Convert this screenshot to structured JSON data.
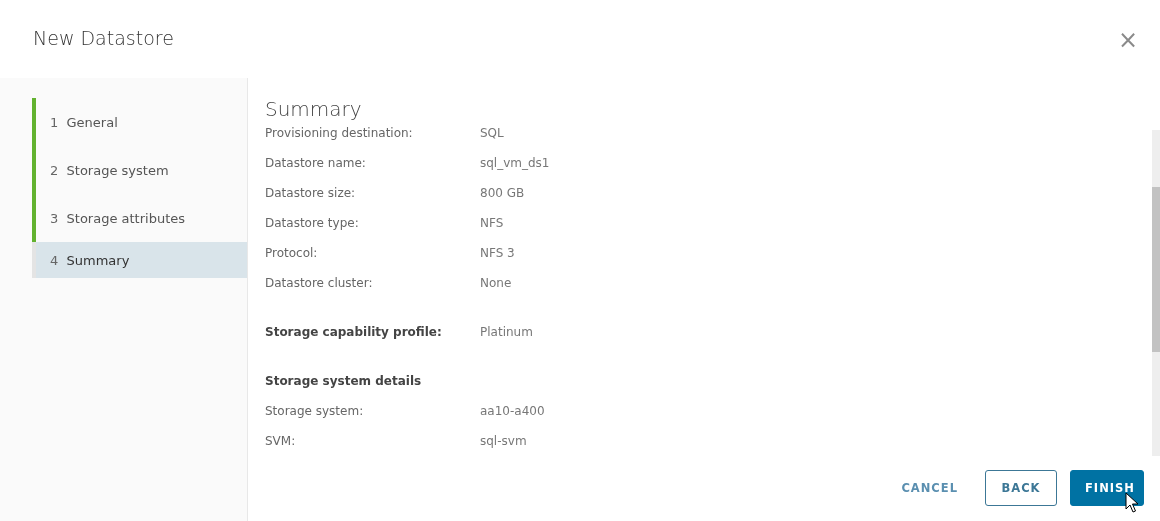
{
  "dialog": {
    "title": "New Datastore",
    "close_label": "×"
  },
  "steps": [
    {
      "number": "1",
      "label": "General",
      "completed": true,
      "selected": false
    },
    {
      "number": "2",
      "label": "Storage system",
      "completed": true,
      "selected": false
    },
    {
      "number": "3",
      "label": "Storage attributes",
      "completed": true,
      "selected": false
    },
    {
      "number": "4",
      "label": "Summary",
      "completed": false,
      "selected": true
    }
  ],
  "content": {
    "heading": "Summary",
    "rows": [
      {
        "kind": "field",
        "label": "Provisioning destination:",
        "value": "SQL"
      },
      {
        "kind": "field",
        "label": "Datastore name:",
        "value": "sql_vm_ds1"
      },
      {
        "kind": "field",
        "label": "Datastore size:",
        "value": "800 GB"
      },
      {
        "kind": "field",
        "label": "Datastore type:",
        "value": "NFS"
      },
      {
        "kind": "field",
        "label": "Protocol:",
        "value": "NFS 3"
      },
      {
        "kind": "field",
        "label": "Datastore cluster:",
        "value": "None"
      },
      {
        "kind": "emphasized",
        "label": "Storage capability profile:",
        "value": "Platinum"
      },
      {
        "kind": "section",
        "label": "Storage system details"
      },
      {
        "kind": "field",
        "label": "Storage system:",
        "value": "aa10-a400"
      },
      {
        "kind": "field",
        "label": "SVM:",
        "value": "sql-svm"
      }
    ]
  },
  "buttons": [
    {
      "kind": "flat",
      "label": "CANCEL"
    },
    {
      "kind": "outline",
      "label": "BACK"
    },
    {
      "kind": "primary",
      "label": "FINISH"
    }
  ]
}
